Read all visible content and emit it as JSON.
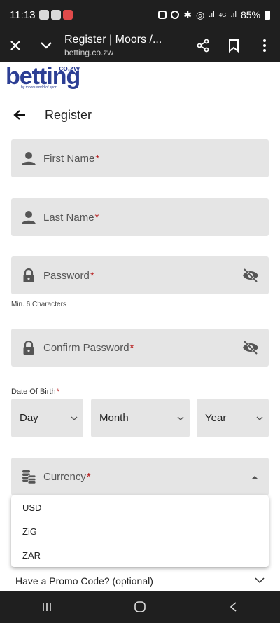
{
  "status_bar": {
    "time": "11:13",
    "network_4g": "4G",
    "battery": "85%"
  },
  "browser": {
    "title": "Register | Moors /...",
    "url": "betting.co.zw"
  },
  "logo": {
    "main": "betting",
    "superscript": "co.zw",
    "tagline": "by moors world of sport"
  },
  "page": {
    "title": "Register"
  },
  "form": {
    "first_name": "First Name",
    "last_name": "Last Name",
    "password": "Password",
    "password_helper": "Min. 6 Characters",
    "confirm_password": "Confirm Password",
    "dob_label": "Date Of Birth",
    "day": "Day",
    "month": "Month",
    "year": "Year",
    "currency": "Currency",
    "required_mark": "*"
  },
  "currency_options": [
    "USD",
    "ZiG",
    "ZAR"
  ],
  "promo": {
    "label": "Have a Promo Code? (optional)"
  },
  "colors": {
    "brand": "#2c3e94",
    "required": "#b71c1c",
    "field_bg": "#e5e5e5",
    "bar_bg": "#1f1f1f"
  }
}
